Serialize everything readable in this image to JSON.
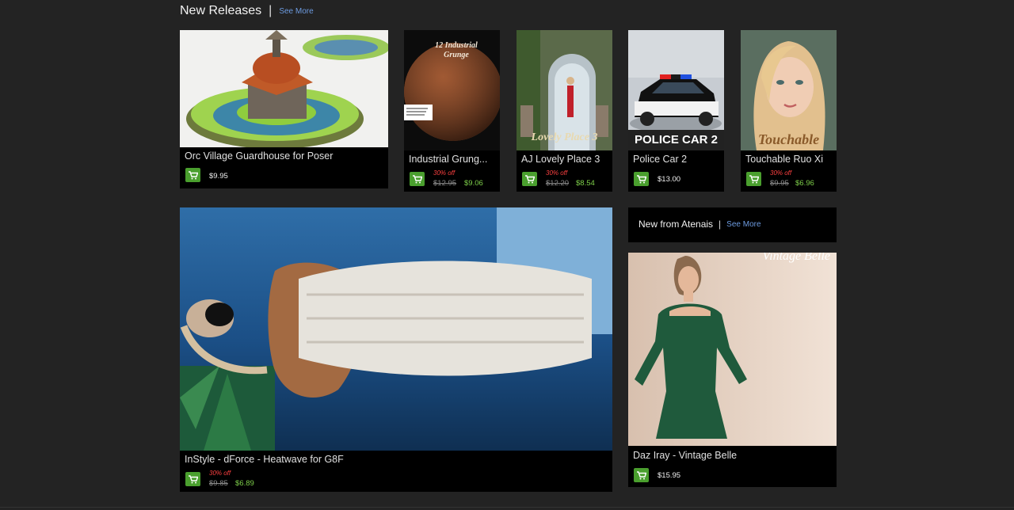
{
  "new_releases": {
    "title": "New Releases",
    "separator": "|",
    "see_more": "See More"
  },
  "products": [
    {
      "name": "Orc Village Guardhouse for Poser",
      "price": "$9.95"
    },
    {
      "name": "Industrial Grung...",
      "discount": "30% off",
      "old_price": "$12.95",
      "sale_price": "$9.06",
      "image_text": "12 Industrial Grunge"
    },
    {
      "name": "AJ Lovely Place 3",
      "discount": "30% off",
      "old_price": "$12.20",
      "sale_price": "$8.54",
      "image_text": "Lovely Place 3"
    },
    {
      "name": "Police Car 2",
      "price": "$13.00",
      "image_text": "POLICE CAR 2"
    },
    {
      "name": "Touchable Ruo Xi",
      "discount": "30% off",
      "old_price": "$9.95",
      "sale_price": "$6.96",
      "image_text": "Touchable"
    }
  ],
  "featured": {
    "name": "InStyle - dForce - Heatwave for G8F",
    "discount": "30% off",
    "old_price": "$9.85",
    "sale_price": "$6.89"
  },
  "atenais": {
    "title": "New from Atenais",
    "separator": "|",
    "see_more": "See More",
    "product": {
      "name": "Daz Iray - Vintage Belle",
      "price": "$15.95",
      "image_text": "Vintage Belle"
    }
  },
  "colors": {
    "background": "#232323",
    "card": "#000000",
    "link": "#6d9be0",
    "cart_button": "#4a9f2e",
    "discount": "#ff4040",
    "sale_price": "#7ed04a"
  },
  "icons": {
    "cart": "shopping-cart-icon"
  }
}
